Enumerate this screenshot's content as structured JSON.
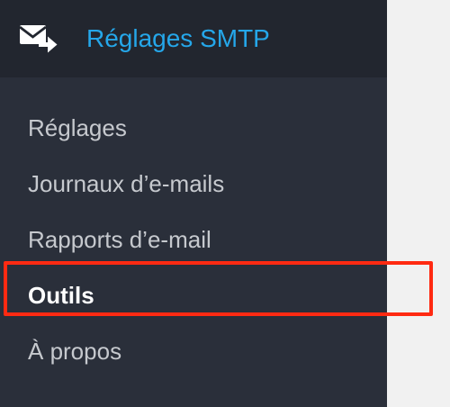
{
  "sidebar": {
    "header": {
      "icon": "mail-forward-icon",
      "title": "Réglages SMTP"
    },
    "items": [
      {
        "label": "Réglages",
        "current": false
      },
      {
        "label": "Journaux d’e-mails",
        "current": false
      },
      {
        "label": "Rapports d’e-mail",
        "current": false
      },
      {
        "label": "Outils",
        "current": true
      },
      {
        "label": "À propos",
        "current": false
      }
    ]
  },
  "annotation": {
    "highlight_color": "#ff2a12",
    "highlighted_item": "Outils"
  },
  "colors": {
    "sidebar_bg": "#2a2f3a",
    "header_bg": "#22262f",
    "title_accent": "#25a7ea",
    "menu_text": "#c6c9ce",
    "menu_text_current": "#ffffff",
    "page_bg": "#f1f1f1"
  }
}
